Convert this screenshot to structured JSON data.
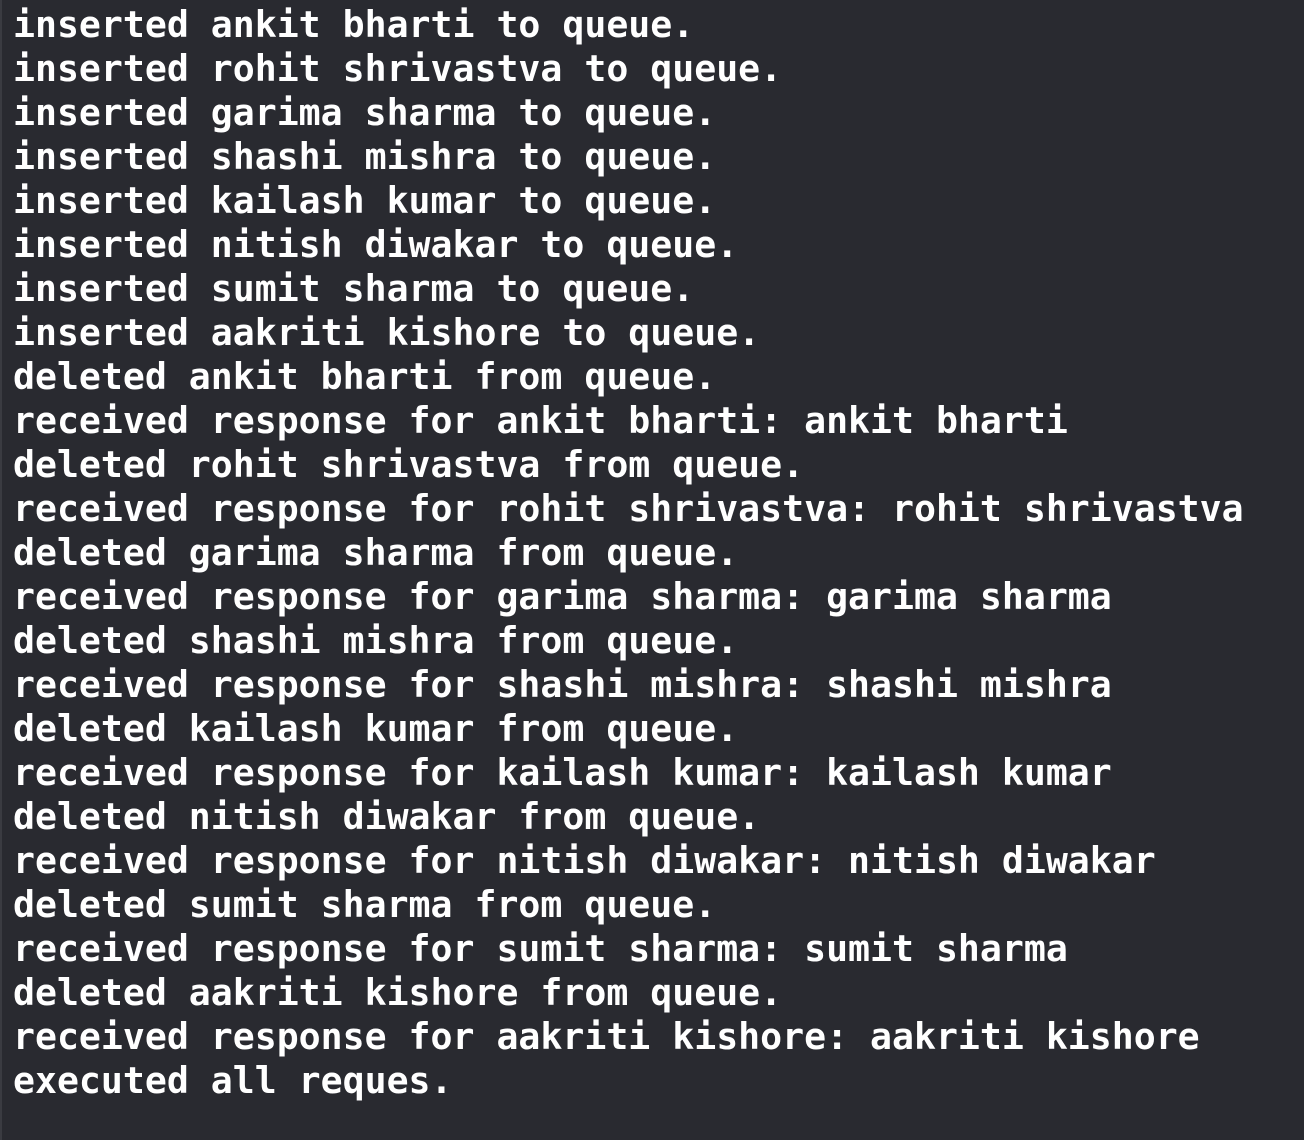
{
  "console": {
    "lines": [
      "inserted ankit bharti to queue.",
      "inserted rohit shrivastva to queue.",
      "inserted garima sharma to queue.",
      "inserted shashi mishra to queue.",
      "inserted kailash kumar to queue.",
      "inserted nitish diwakar to queue.",
      "inserted sumit sharma to queue.",
      "inserted aakriti kishore to queue.",
      "deleted ankit bharti from queue.",
      "received response for ankit bharti: ankit bharti",
      "deleted rohit shrivastva from queue.",
      "received response for rohit shrivastva: rohit shrivastva",
      "deleted garima sharma from queue.",
      "received response for garima sharma: garima sharma",
      "deleted shashi mishra from queue.",
      "received response for shashi mishra: shashi mishra",
      "deleted kailash kumar from queue.",
      "received response for kailash kumar: kailash kumar",
      "deleted nitish diwakar from queue.",
      "received response for nitish diwakar: nitish diwakar",
      "deleted sumit sharma from queue.",
      "received response for sumit sharma: sumit sharma",
      "deleted aakriti kishore from queue.",
      "received response for aakriti kishore: aakriti kishore",
      "executed all reques."
    ]
  }
}
